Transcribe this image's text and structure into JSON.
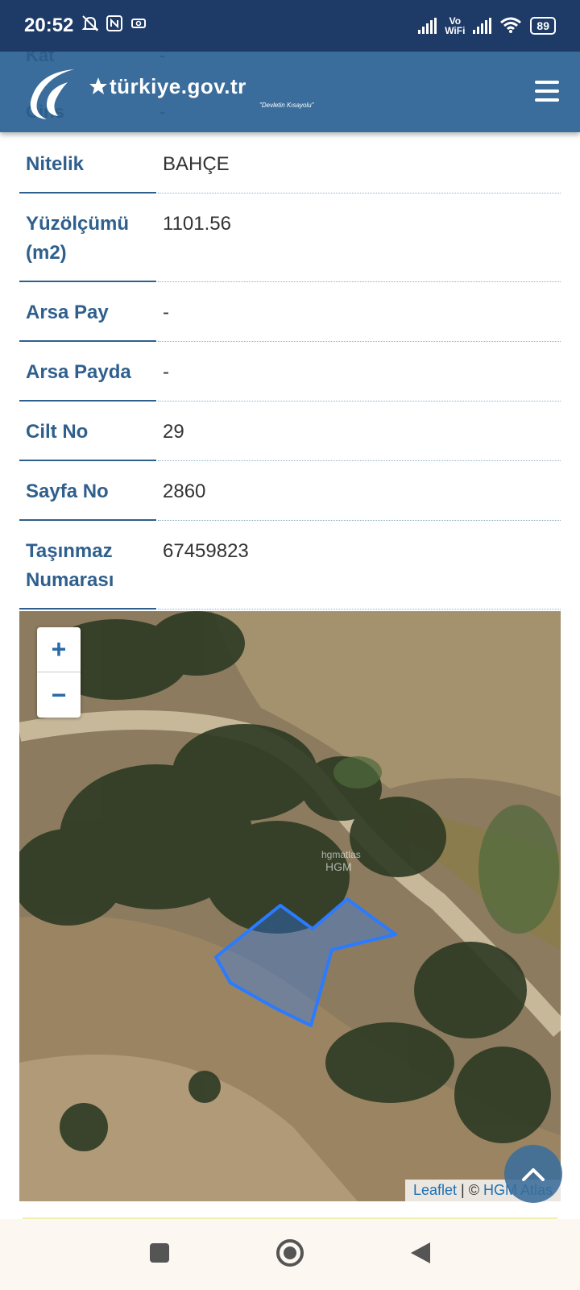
{
  "status_bar": {
    "time": "20:52",
    "vowifi_top": "Vo",
    "vowifi_bottom": "WiFi",
    "battery": "89"
  },
  "header": {
    "brand": "türkiye.gov.tr",
    "slogan": "\"Devletin Kısayolu\"",
    "ghost_row_1_label": "Kat",
    "ghost_row_1_value": "-",
    "ghost_row_2_label": "Cins",
    "ghost_row_2_value": "-"
  },
  "details": [
    {
      "label": "Nitelik",
      "value": "BAHÇE"
    },
    {
      "label": "Yüzölçümü (m2)",
      "value": "1101.56"
    },
    {
      "label": "Arsa Pay",
      "value": "-"
    },
    {
      "label": "Arsa Payda",
      "value": "-"
    },
    {
      "label": "Cilt No",
      "value": "29"
    },
    {
      "label": "Sayfa No",
      "value": "2860"
    },
    {
      "label": "Taşınmaz Numarası",
      "value": "67459823"
    }
  ],
  "map": {
    "zoom_in": "+",
    "zoom_out": "−",
    "watermark_1": "hgmatlas",
    "watermark_2": "HGM",
    "attribution_leaflet": "Leaflet",
    "attribution_separator": " | © ",
    "attribution_hgm": "HGM Atlas",
    "parcel_color": "#2b7bff"
  },
  "colors": {
    "header": "#3a6d9b",
    "status_bar": "#1e3a66",
    "label": "#2f5f8d"
  }
}
